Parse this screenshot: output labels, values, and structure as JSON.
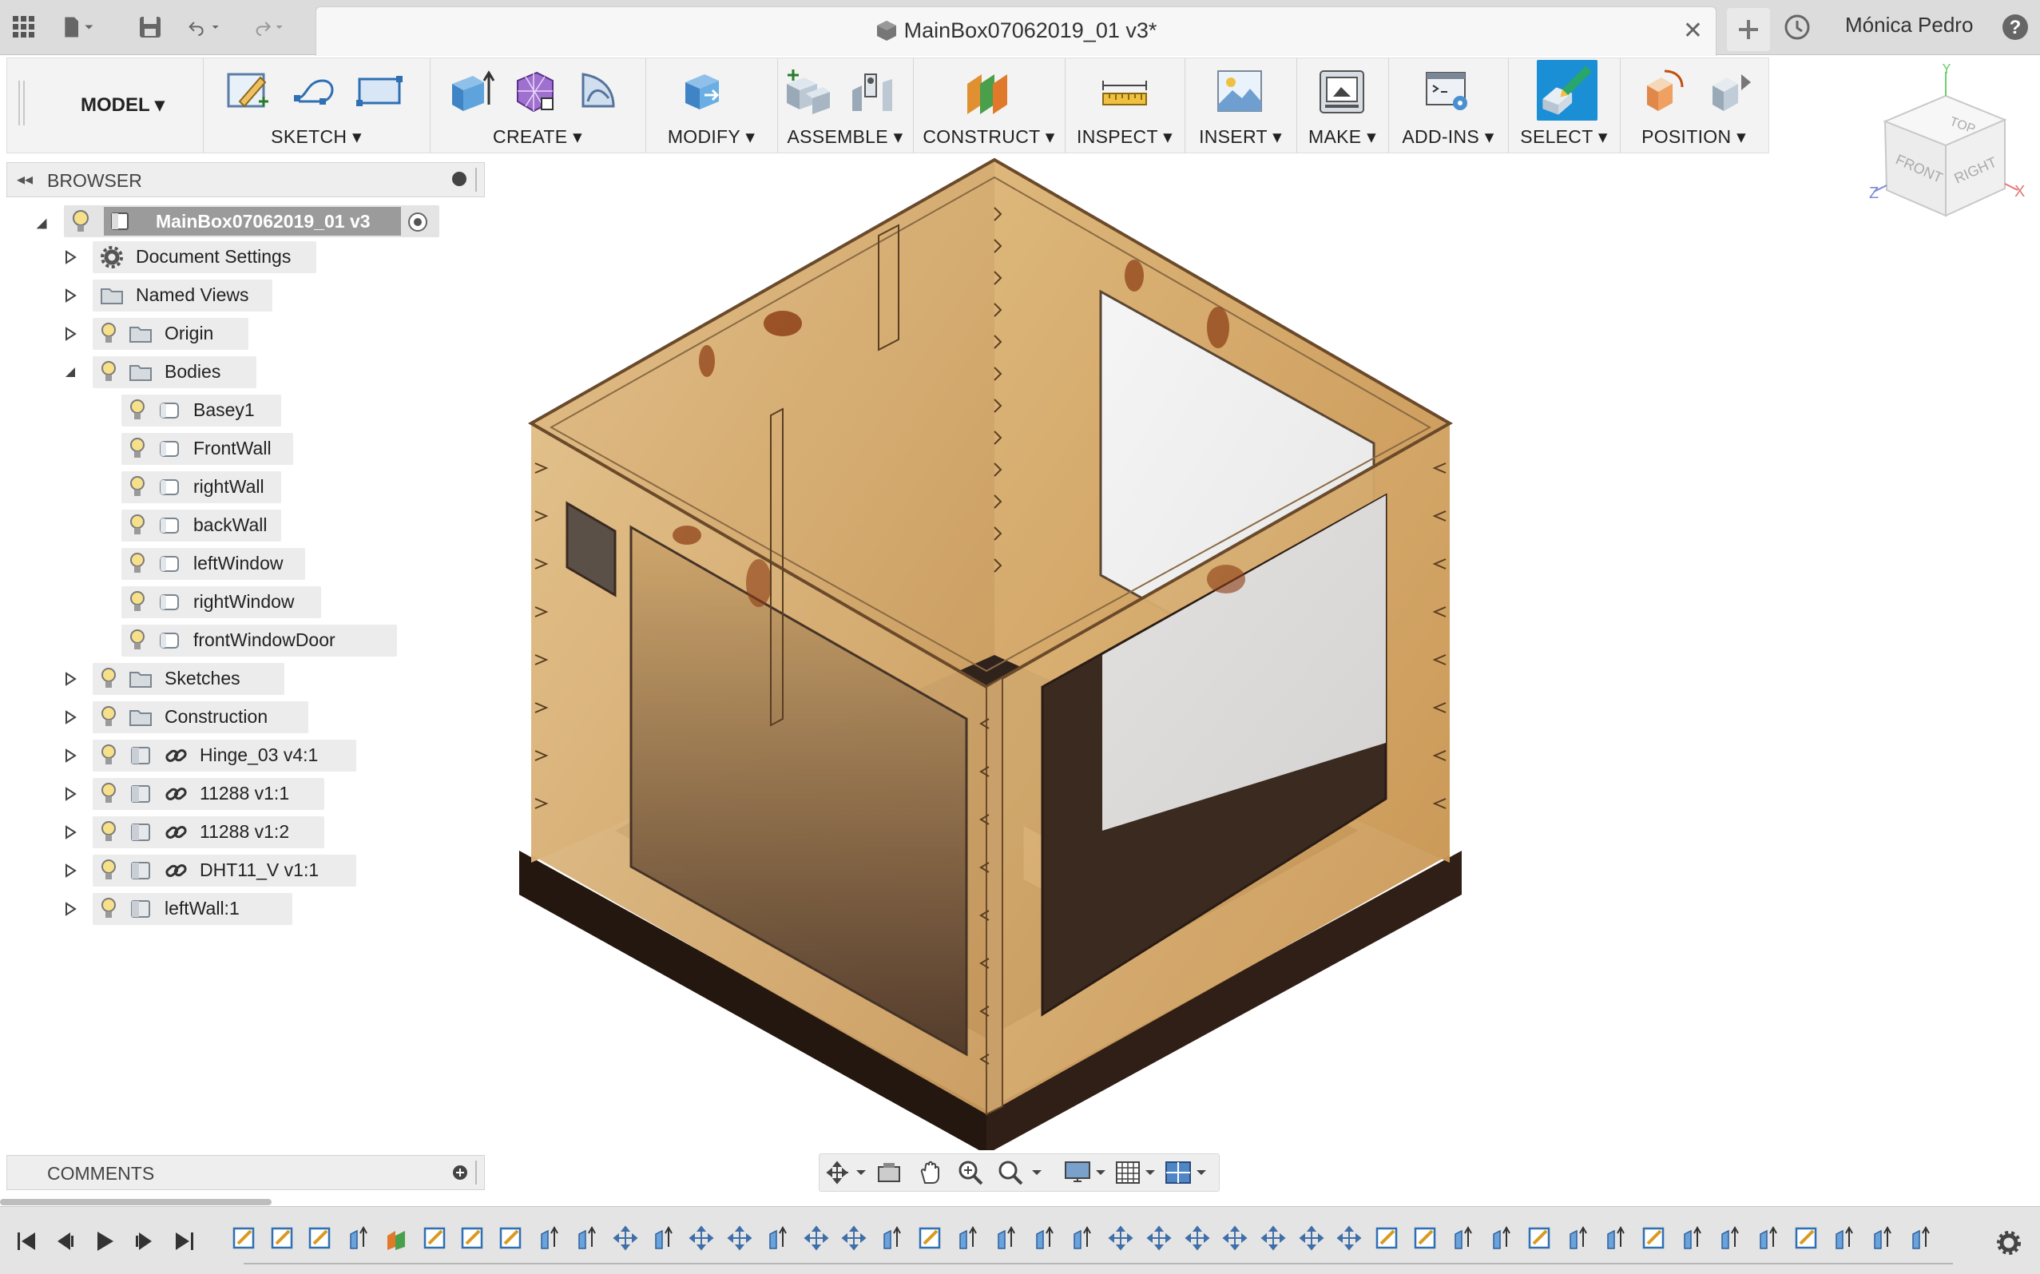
{
  "window": {
    "document_title": "MainBox07062019_01 v3*",
    "user_name": "Mónica Pedro"
  },
  "toolbar": {
    "workspace_label": "MODEL",
    "groups": [
      {
        "label": "SKETCH"
      },
      {
        "label": "CREATE"
      },
      {
        "label": "MODIFY"
      },
      {
        "label": "ASSEMBLE"
      },
      {
        "label": "CONSTRUCT"
      },
      {
        "label": "INSPECT"
      },
      {
        "label": "INSERT"
      },
      {
        "label": "MAKE"
      },
      {
        "label": "ADD-INS"
      },
      {
        "label": "SELECT"
      },
      {
        "label": "POSITION"
      }
    ]
  },
  "viewcube": {
    "top": "TOP",
    "front": "FRONT",
    "right": "RIGHT",
    "axis_x": "X",
    "axis_y": "Y",
    "axis_z": "Z"
  },
  "browser": {
    "title": "BROWSER",
    "root": "MainBox07062019_01 v3",
    "items": [
      {
        "label": "Document Settings",
        "icon": "gear-icon"
      },
      {
        "label": "Named Views",
        "icon": "folder-icon"
      },
      {
        "label": "Origin",
        "icon": "folder-icon"
      },
      {
        "label": "Bodies",
        "icon": "folder-icon"
      },
      {
        "label": "Basey1",
        "icon": "body-icon"
      },
      {
        "label": "FrontWall",
        "icon": "body-icon"
      },
      {
        "label": "rightWall",
        "icon": "body-icon"
      },
      {
        "label": "backWall",
        "icon": "body-icon"
      },
      {
        "label": "leftWindow",
        "icon": "body-icon"
      },
      {
        "label": "rightWindow",
        "icon": "body-icon"
      },
      {
        "label": "frontWindowDoor",
        "icon": "body-icon"
      },
      {
        "label": "Sketches",
        "icon": "folder-icon"
      },
      {
        "label": "Construction",
        "icon": "folder-icon"
      },
      {
        "label": "Hinge_03 v4:1",
        "icon": "component-link-icon"
      },
      {
        "label": "11288 v1:1",
        "icon": "component-link-icon"
      },
      {
        "label": "11288 v1:2",
        "icon": "component-link-icon"
      },
      {
        "label": "DHT11_V v1:1",
        "icon": "component-link-icon"
      },
      {
        "label": "leftWall:1",
        "icon": "component-icon"
      }
    ]
  },
  "comments": {
    "title": "COMMENTS"
  },
  "colors": {
    "accent_select": "#1a8fd6",
    "wood_light": "#d8b47a",
    "wood_dark": "#3b2a20"
  }
}
